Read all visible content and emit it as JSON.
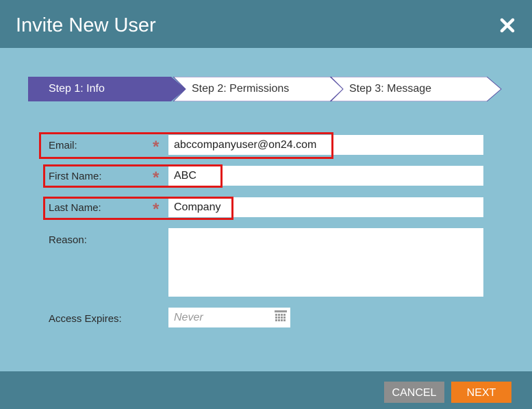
{
  "dialog": {
    "title": "Invite New User",
    "close_icon": "close-icon"
  },
  "steps": [
    {
      "label": "Step 1: Info",
      "active": true
    },
    {
      "label": "Step 2: Permissions",
      "active": false
    },
    {
      "label": "Step 3: Message",
      "active": false
    }
  ],
  "form": {
    "email": {
      "label": "Email:",
      "value": "abccompanyuser@on24.com",
      "required": "*"
    },
    "first_name": {
      "label": "First Name:",
      "value": "ABC",
      "required": "*"
    },
    "last_name": {
      "label": "Last Name:",
      "value": "Company",
      "required": "*"
    },
    "reason": {
      "label": "Reason:",
      "value": ""
    },
    "access_expires": {
      "label": "Access Expires:",
      "placeholder": "Never",
      "icon": "calendar-icon"
    }
  },
  "buttons": {
    "cancel": "CANCEL",
    "next": "NEXT"
  },
  "colors": {
    "header": "#487f91",
    "body": "#8ac1d3",
    "active_step": "#5c54a4",
    "next_button": "#f07d1c",
    "cancel_button": "#8d8d8d",
    "highlight": "#e01818"
  }
}
